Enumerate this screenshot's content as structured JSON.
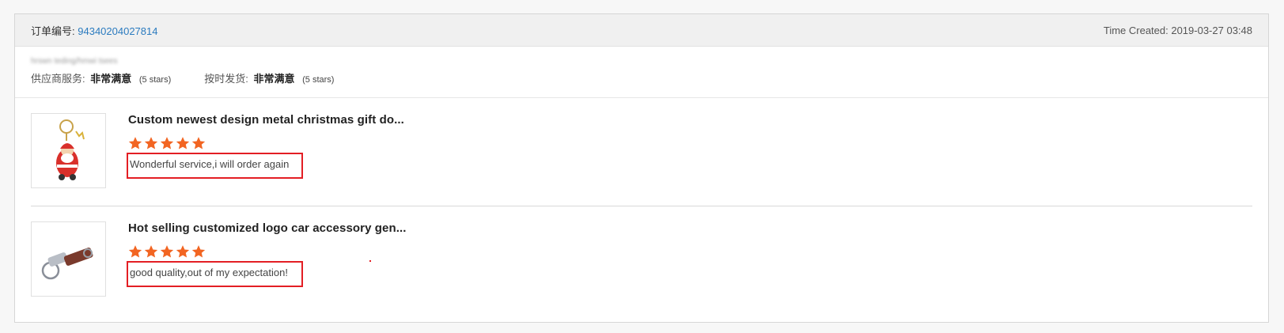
{
  "order": {
    "label": "订单编号:",
    "number": "94340204027814",
    "time_created": "Time Created: 2019-03-27 03:48"
  },
  "supplier": {
    "name_blurred": "hrswn teding/hmwi tsees",
    "service_label": "供应商服务:",
    "service_value": "非常满意",
    "service_stars": "(5 stars)",
    "delivery_label": "按时发货:",
    "delivery_value": "非常满意",
    "delivery_stars": "(5 stars)"
  },
  "products": [
    {
      "title": "Custom newest design metal christmas gift do...",
      "rating": 5,
      "review": "Wonderful service,i will order again",
      "image_icon": "santa-keychain-image"
    },
    {
      "title": "Hot selling customized logo car accessory gen...",
      "rating": 5,
      "review": "good quality,out of my expectation!",
      "image_icon": "leather-keychain-image"
    }
  ],
  "colors": {
    "star": "#f26522",
    "highlight_box": "#e31e24",
    "order_link": "#2b7bbf"
  }
}
